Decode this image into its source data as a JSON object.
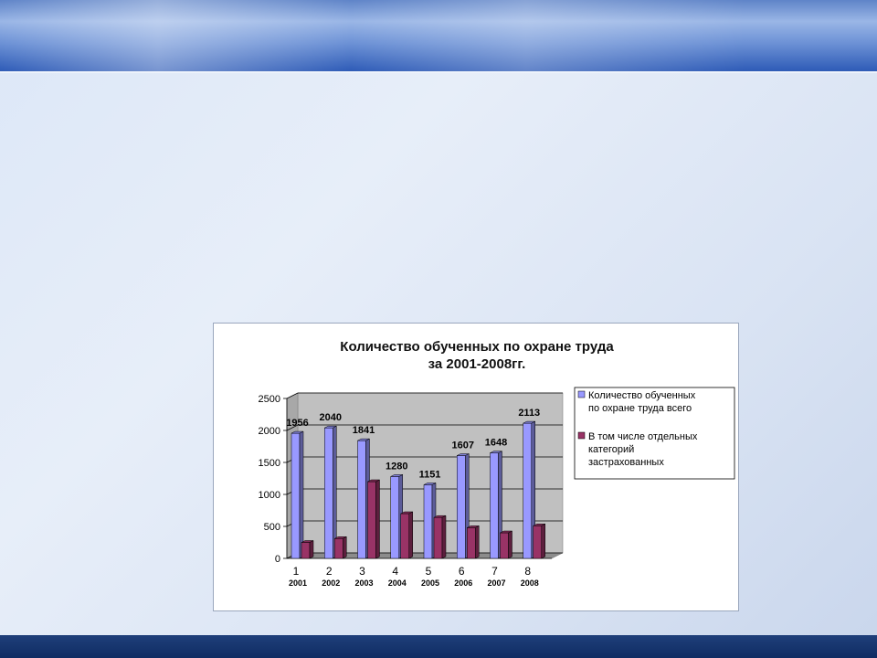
{
  "chart_data": {
    "type": "bar",
    "title_line1": "Количество обученных по охране труда",
    "title_line2": "за 2001-2008гг.",
    "categories": [
      "1",
      "2",
      "3",
      "4",
      "5",
      "6",
      "7",
      "8"
    ],
    "category_years": [
      "2001",
      "2002",
      "2003",
      "2004",
      "2005",
      "2006",
      "2007",
      "2008"
    ],
    "series": [
      {
        "name_lines": [
          "Количество обученных",
          "по охране труда всего"
        ],
        "values": [
          1956,
          2040,
          1841,
          1280,
          1151,
          1607,
          1648,
          2113
        ],
        "color": "#9999ff",
        "data_labels": [
          "1956",
          "2040",
          "1841",
          "1280",
          "1151",
          "1607",
          "1648",
          "2113"
        ]
      },
      {
        "name_lines": [
          "В том числе отдельных",
          "категорий",
          "застрахованных"
        ],
        "values": [
          250,
          310,
          1200,
          700,
          640,
          480,
          400,
          510
        ],
        "color": "#993366"
      }
    ],
    "yticks": [
      "0",
      "500",
      "1000",
      "1500",
      "2000",
      "2500"
    ],
    "ylim": [
      0,
      2500
    ],
    "grid": true,
    "legend": "right"
  }
}
